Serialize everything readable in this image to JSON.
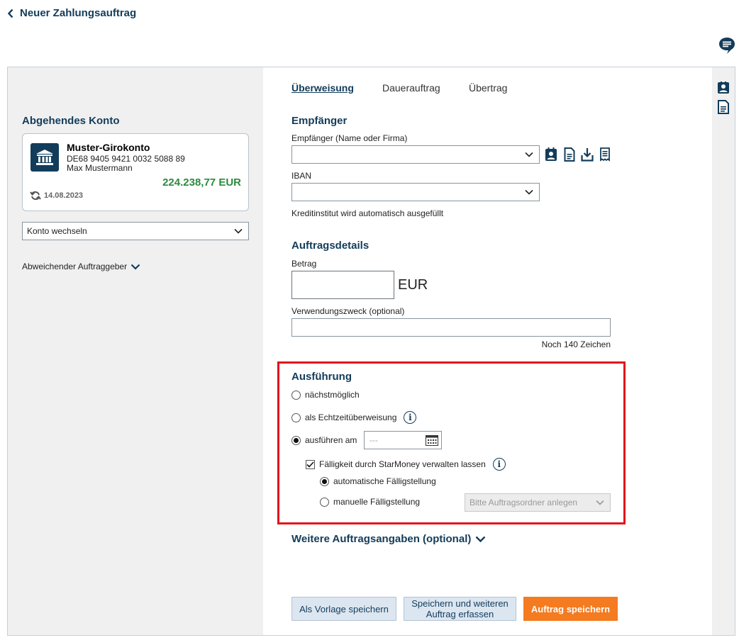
{
  "header": {
    "back_label": "Neuer Zahlungsauftrag"
  },
  "left": {
    "section_title": "Abgehendes Konto",
    "account": {
      "name": "Muster-Girokonto",
      "iban": "DE68 9405 9421 0032 5088 89",
      "owner": "Max Mustermann",
      "balance": "224.238,77 EUR",
      "date": "14.08.2023"
    },
    "switch_select": "Konto wechseln",
    "deviating_label": "Abweichender Auftraggeber"
  },
  "tabs": [
    {
      "label": "Überweisung",
      "active": true
    },
    {
      "label": "Dauerauftrag",
      "active": false
    },
    {
      "label": "Übertrag",
      "active": false
    }
  ],
  "recipient": {
    "title": "Empfänger",
    "name_label": "Empfänger (Name oder Firma)",
    "name_value": "",
    "iban_label": "IBAN",
    "iban_value": "",
    "bank_hint": "Kreditinstitut wird automatisch ausgefüllt"
  },
  "details": {
    "title": "Auftragsdetails",
    "amount_label": "Betrag",
    "amount_value": "",
    "currency": "EUR",
    "purpose_label": "Verwendungszweck (optional)",
    "purpose_value": "",
    "chars_left": "Noch 140 Zeichen"
  },
  "execution": {
    "title": "Ausführung",
    "opt_next": "nächstmöglich",
    "opt_instant": "als Echtzeitüberweisung",
    "opt_date": "ausführen am",
    "date_placeholder": "---",
    "selected": "ausführen am",
    "due_checkbox_label": "Fälligkeit durch StarMoney verwalten lassen",
    "due_checked": true,
    "auto_label": "automatische Fälligstellung",
    "manual_label": "manuelle Fälligstellung",
    "due_mode": "automatische Fälligstellung",
    "folder_select": "Bitte Auftragsordner anlegen"
  },
  "more_label": "Weitere Auftragsangaben (optional)",
  "buttons": {
    "template": "Als Vorlage speichern",
    "save_more_line1": "Speichern und weiteren",
    "save_more_line2": "Auftrag erfassen",
    "save": "Auftrag speichern"
  },
  "colors": {
    "navy": "#123c5a",
    "accent": "#f47b20",
    "positive": "#2b8a3e",
    "highlight": "#e0151b"
  }
}
